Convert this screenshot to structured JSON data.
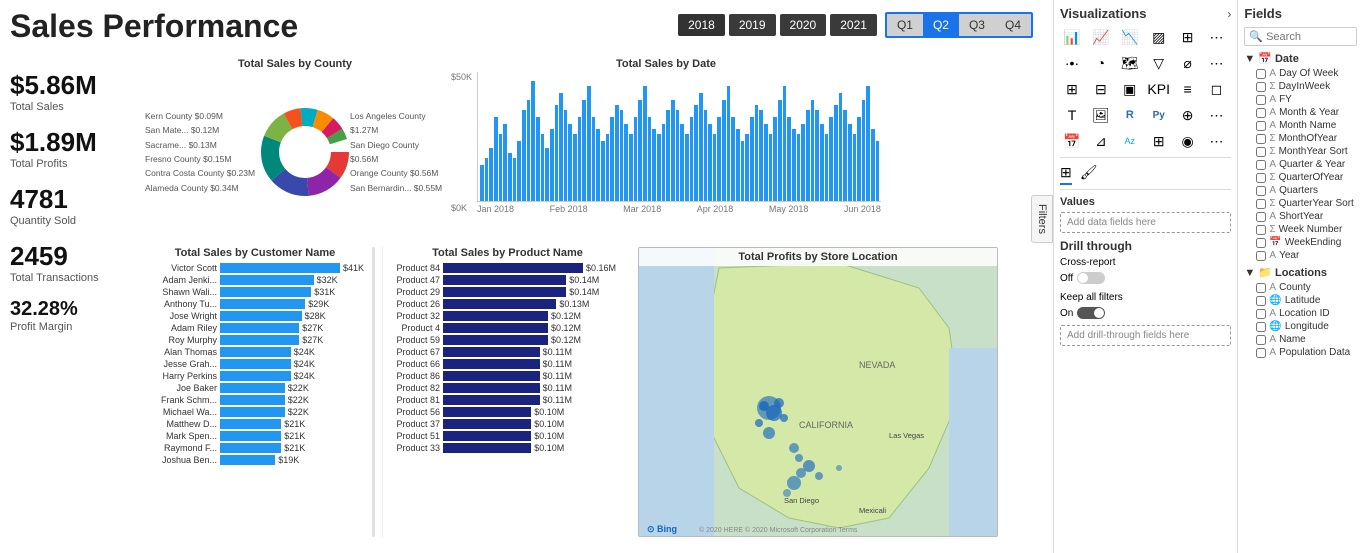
{
  "header": {
    "title": "Sales Performance"
  },
  "yearTabs": [
    "2018",
    "2019",
    "2020",
    "2021"
  ],
  "activeYear": "2018",
  "quarterTabs": [
    "Q1",
    "Q2",
    "Q3",
    "Q4"
  ],
  "activeQuarter": "Q2",
  "kpis": [
    {
      "value": "$5.86M",
      "label": "Total Sales"
    },
    {
      "value": "$1.89M",
      "label": "Total Profits"
    },
    {
      "value": "4781",
      "label": "Quantity Sold"
    },
    {
      "value": "2459",
      "label": "Total Transactions"
    },
    {
      "value": "32.28%",
      "label": "Profit Margin"
    }
  ],
  "charts": {
    "donut": {
      "title": "Total Sales by County",
      "legendLeft": [
        "Kern County $0.09M",
        "San Mate... $0.12M",
        "Sacrame... $0.13M",
        "Fresno County $0.15M",
        "Contra Costa County $0.23M",
        "Alameda County $0.34M"
      ],
      "legendRight": [
        "Los Angeles County $1.27M",
        "San Diego County $0.56M",
        "Orange County $0.56M",
        "San Bernardin... $0.55M"
      ],
      "colors": [
        "#e53935",
        "#8e24aa",
        "#3949ab",
        "#00897b",
        "#7cb342",
        "#f4511e",
        "#00acc1",
        "#fb8c00",
        "#d81b60",
        "#43a047"
      ]
    },
    "lineBar": {
      "title": "Total Sales by Date",
      "yLabels": [
        "$50K",
        "$0K"
      ],
      "xLabels": [
        "Jan 2018",
        "Feb 2018",
        "Mar 2018",
        "Apr 2018",
        "May 2018",
        "Jun 2018"
      ],
      "bars": [
        15,
        18,
        22,
        35,
        28,
        32,
        20,
        18,
        25,
        38,
        42,
        50,
        35,
        28,
        22,
        30,
        40,
        45,
        38,
        32,
        28,
        35,
        42,
        48,
        35,
        30,
        25,
        28,
        35,
        40,
        38,
        32,
        28,
        35,
        42,
        48,
        35,
        30,
        28,
        32,
        38,
        42,
        38,
        32,
        28,
        35,
        40,
        45,
        38,
        32,
        28,
        35,
        42,
        48,
        35,
        30,
        25,
        28,
        35,
        40,
        38,
        32,
        28,
        35,
        42,
        48,
        35,
        30,
        28,
        32,
        38,
        42,
        38,
        32,
        28,
        35,
        40,
        45,
        38,
        32,
        28,
        35,
        42,
        48,
        30,
        25
      ]
    },
    "customerBars": {
      "title": "Total Sales by Customer Name",
      "items": [
        {
          "name": "Victor Scott",
          "val": "$41K",
          "pct": 100
        },
        {
          "name": "Adam Jenki...",
          "val": "$32K",
          "pct": 78
        },
        {
          "name": "Shawn Wali...",
          "val": "$31K",
          "pct": 76
        },
        {
          "name": "Anthony Tu...",
          "val": "$29K",
          "pct": 71
        },
        {
          "name": "Jose Wright",
          "val": "$28K",
          "pct": 68
        },
        {
          "name": "Adam Riley",
          "val": "$27K",
          "pct": 66
        },
        {
          "name": "Roy Murphy",
          "val": "$27K",
          "pct": 66
        },
        {
          "name": "Alan Thomas",
          "val": "$24K",
          "pct": 59
        },
        {
          "name": "Jesse Grah...",
          "val": "$24K",
          "pct": 59
        },
        {
          "name": "Harry Perkins",
          "val": "$24K",
          "pct": 59
        },
        {
          "name": "Joe Baker",
          "val": "$22K",
          "pct": 54
        },
        {
          "name": "Frank Schm...",
          "val": "$22K",
          "pct": 54
        },
        {
          "name": "Michael Wa...",
          "val": "$22K",
          "pct": 54
        },
        {
          "name": "Matthew D...",
          "val": "$21K",
          "pct": 51
        },
        {
          "name": "Mark Spen...",
          "val": "$21K",
          "pct": 51
        },
        {
          "name": "Raymond F...",
          "val": "$21K",
          "pct": 51
        },
        {
          "name": "Joshua Ben...",
          "val": "$19K",
          "pct": 46
        }
      ]
    },
    "productBars": {
      "title": "Total Sales by Product Name",
      "items": [
        {
          "name": "Product 84",
          "val": "$0.16M",
          "pct": 100
        },
        {
          "name": "Product 47",
          "val": "$0.14M",
          "pct": 88
        },
        {
          "name": "Product 29",
          "val": "$0.14M",
          "pct": 88
        },
        {
          "name": "Product 26",
          "val": "$0.13M",
          "pct": 81
        },
        {
          "name": "Product 32",
          "val": "$0.12M",
          "pct": 75
        },
        {
          "name": "Product 4",
          "val": "$0.12M",
          "pct": 75
        },
        {
          "name": "Product 59",
          "val": "$0.12M",
          "pct": 75
        },
        {
          "name": "Product 67",
          "val": "$0.11M",
          "pct": 69
        },
        {
          "name": "Product 66",
          "val": "$0.11M",
          "pct": 69
        },
        {
          "name": "Product 86",
          "val": "$0.11M",
          "pct": 69
        },
        {
          "name": "Product 82",
          "val": "$0.11M",
          "pct": 69
        },
        {
          "name": "Product 81",
          "val": "$0.11M",
          "pct": 69
        },
        {
          "name": "Product 56",
          "val": "$0.10M",
          "pct": 63
        },
        {
          "name": "Product 37",
          "val": "$0.10M",
          "pct": 63
        },
        {
          "name": "Product 51",
          "val": "$0.10M",
          "pct": 63
        },
        {
          "name": "Product 33",
          "val": "$0.10M",
          "pct": 63
        }
      ]
    },
    "map": {
      "title": "Total Profits by Store Location"
    }
  },
  "filters": {
    "label": "Filters"
  },
  "rightPanel": {
    "viz": {
      "title": "Visualizations",
      "values_label": "Values",
      "add_data_placeholder": "Add data fields here",
      "drill_title": "Drill through",
      "cross_report_label": "Cross-report",
      "off_label": "Off",
      "keep_filters_label": "Keep all filters",
      "on_label": "On",
      "add_drill_placeholder": "Add drill-through fields here"
    },
    "fields": {
      "title": "Fields",
      "search_placeholder": "Search",
      "sections": [
        {
          "name": "Date",
          "icon": "📅",
          "items": [
            {
              "label": "Day Of Week",
              "type": "text",
              "checked": false
            },
            {
              "label": "DayInWeek",
              "type": "sigma",
              "checked": false
            },
            {
              "label": "FY",
              "type": "text",
              "checked": false
            },
            {
              "label": "Month & Year",
              "type": "text",
              "checked": false
            },
            {
              "label": "Month Name",
              "type": "text",
              "checked": false
            },
            {
              "label": "MonthOfYear",
              "type": "sigma",
              "checked": false
            },
            {
              "label": "MonthYear Sort",
              "type": "sigma",
              "checked": false
            },
            {
              "label": "Quarter & Year",
              "type": "text",
              "checked": false
            },
            {
              "label": "QuarterOfYear",
              "type": "sigma",
              "checked": false
            },
            {
              "label": "Quarters",
              "type": "text",
              "checked": false
            },
            {
              "label": "QuarterYear Sort",
              "type": "sigma",
              "checked": false
            },
            {
              "label": "ShortYear",
              "type": "text",
              "checked": false
            },
            {
              "label": "Week Number",
              "type": "sigma",
              "checked": false
            },
            {
              "label": "WeekEnding",
              "type": "calendar",
              "checked": false
            },
            {
              "label": "Year",
              "type": "text",
              "checked": false
            }
          ]
        },
        {
          "name": "Locations",
          "icon": "📁",
          "items": [
            {
              "label": "County",
              "type": "text",
              "checked": false
            },
            {
              "label": "Latitude",
              "type": "globe",
              "checked": false
            },
            {
              "label": "Location ID",
              "type": "text",
              "checked": false
            },
            {
              "label": "Longitude",
              "type": "globe",
              "checked": false
            },
            {
              "label": "Name",
              "type": "text",
              "checked": false
            },
            {
              "label": "Population Data",
              "type": "text",
              "checked": false
            }
          ]
        }
      ]
    }
  }
}
